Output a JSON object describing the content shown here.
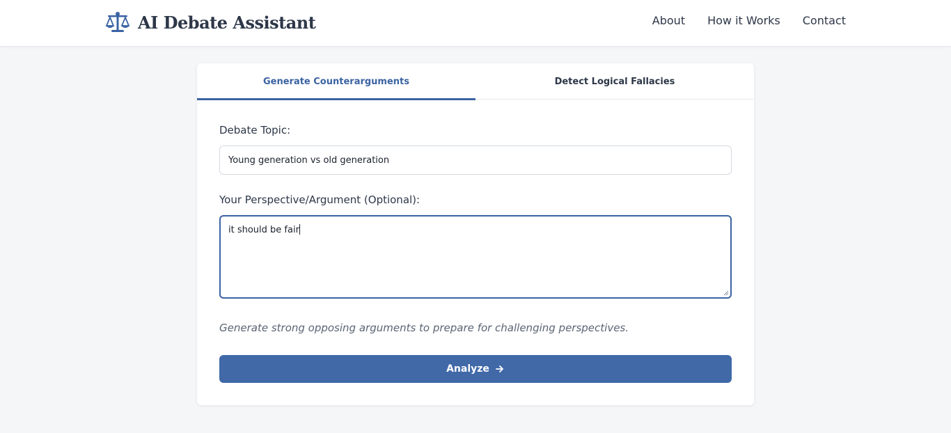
{
  "header": {
    "title": "AI Debate Assistant",
    "logo_icon": "balance-scale-icon",
    "nav": [
      "About",
      "How it Works",
      "Contact"
    ]
  },
  "tabs": [
    {
      "label": "Generate Counterarguments",
      "active": true
    },
    {
      "label": "Detect Logical Fallacies",
      "active": false
    }
  ],
  "form": {
    "topic_label": "Debate Topic:",
    "topic_value": "Young generation vs old generation",
    "perspective_label": "Your Perspective/Argument (Optional):",
    "perspective_value": "it should be fair",
    "hint": "Generate strong opposing arguments to prepare for challenging perspectives.",
    "submit_label": "Analyze",
    "submit_icon": "arrow-right-icon"
  },
  "colors": {
    "accent": "#3b63a3",
    "button": "#4169a8",
    "background": "#f5f6f8"
  }
}
